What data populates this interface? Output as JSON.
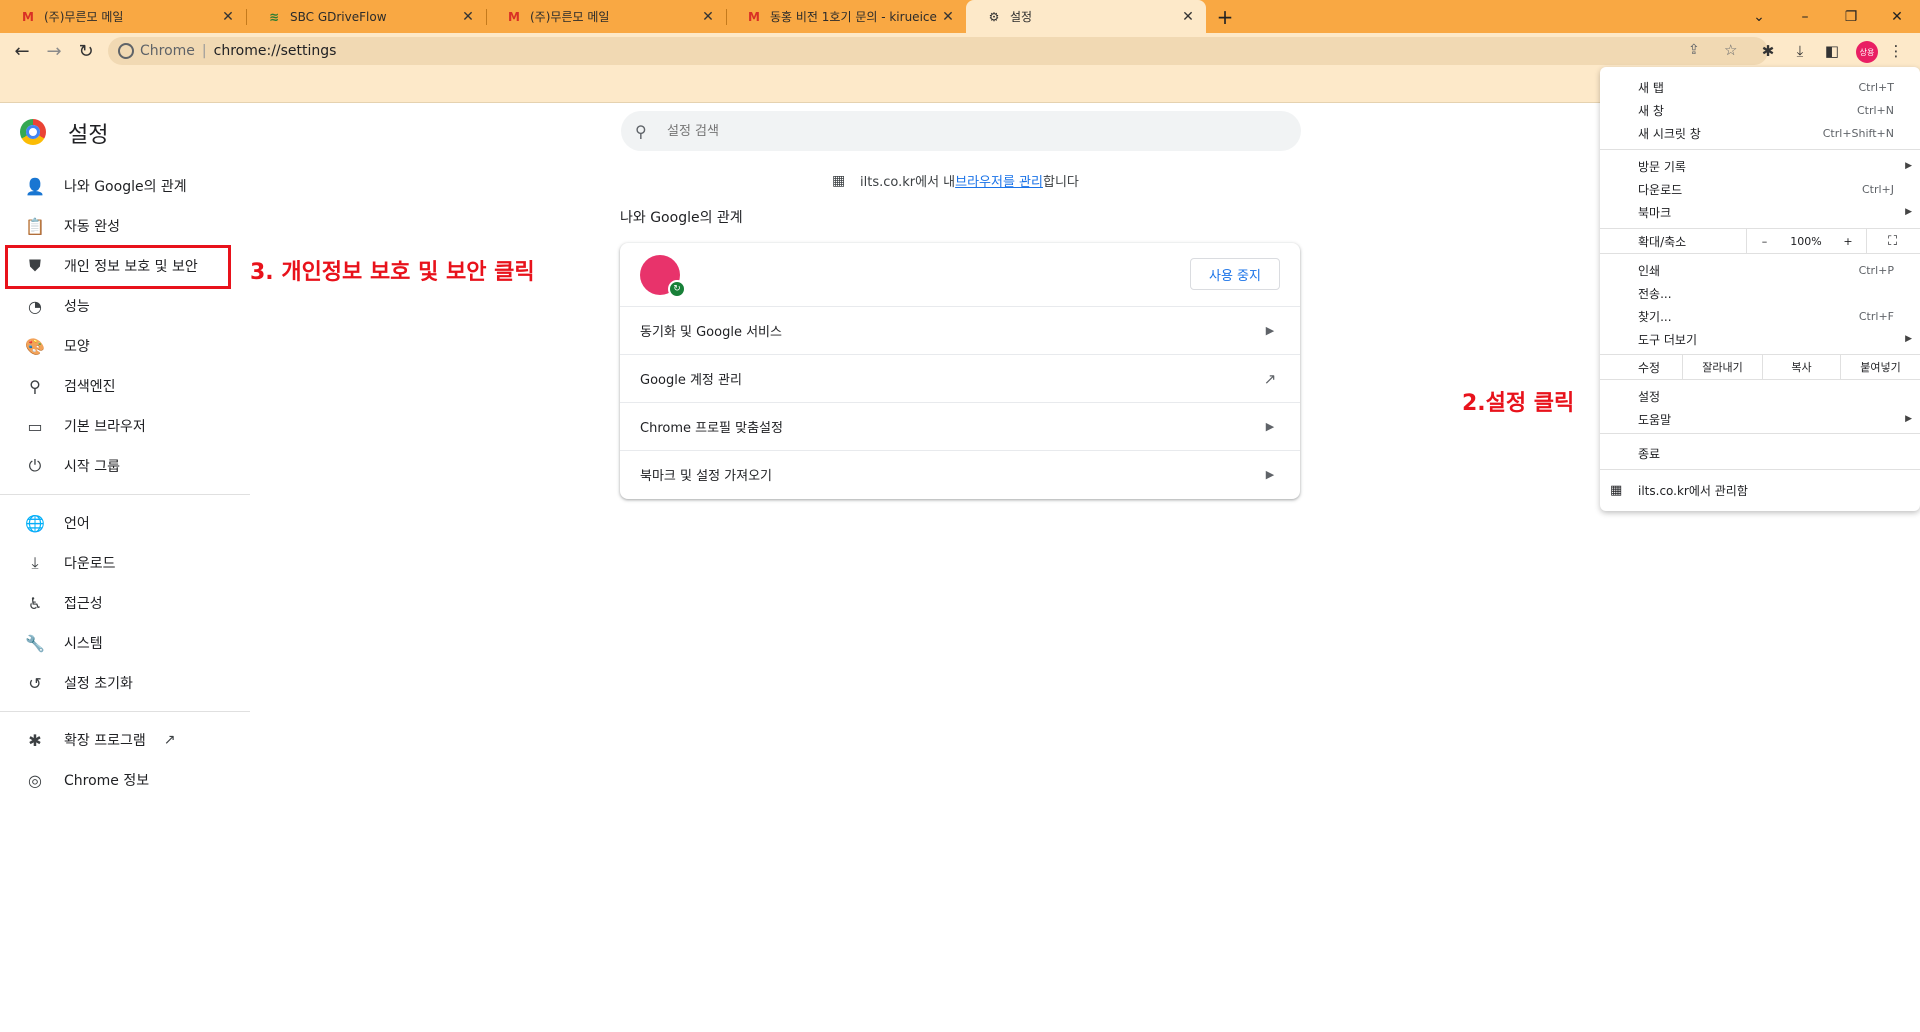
{
  "tabs": [
    {
      "label": "(주)무른모 메일",
      "icon": "gmail-icon"
    },
    {
      "label": "SBC GDriveFlow",
      "icon": "gdriveflow-icon"
    },
    {
      "label": "(주)무른모 메일",
      "icon": "gmail-icon"
    },
    {
      "label": "동홍 비전 1호기 문의 - kirueice",
      "icon": "gmail-icon"
    },
    {
      "label": "설정",
      "icon": "gear-icon"
    }
  ],
  "omnibox": {
    "scheme": "Chrome",
    "url": "chrome://settings"
  },
  "profile": {
    "initials": "상용"
  },
  "settings": {
    "title": "설정",
    "search_placeholder": "설정 검색",
    "managed_prefix": "ilts.co.kr에서 내 ",
    "managed_link": "브라우저를 관리",
    "managed_suffix": "합니다",
    "section_title": "나와 Google의 관계",
    "stop_button": "사용 중지",
    "rows": [
      "동기화 및 Google 서비스",
      "Google 계정 관리",
      "Chrome 프로필 맞춤설정",
      "북마크 및 설정 가져오기"
    ]
  },
  "sidebar": {
    "items": [
      "나와 Google의 관계",
      "자동 완성",
      "개인 정보 보호 및 보안",
      "성능",
      "모양",
      "검색엔진",
      "기본 브라우저",
      "시작 그룹",
      "언어",
      "다운로드",
      "접근성",
      "시스템",
      "설정 초기화",
      "확장 프로그램",
      "Chrome 정보"
    ]
  },
  "annotations": {
    "step3": "3. 개인정보 보호 및 보안 클릭",
    "step2": "2.설정 클릭"
  },
  "menu": {
    "new_tab": "새 탭",
    "new_tab_sc": "Ctrl+T",
    "new_window": "새 창",
    "new_window_sc": "Ctrl+N",
    "incognito": "새 시크릿 창",
    "incognito_sc": "Ctrl+Shift+N",
    "history": "방문 기록",
    "downloads": "다운로드",
    "downloads_sc": "Ctrl+J",
    "bookmarks": "북마크",
    "zoom_label": "확대/축소",
    "zoom_minus": "–",
    "zoom_value": "100%",
    "zoom_plus": "+",
    "print": "인쇄",
    "print_sc": "Ctrl+P",
    "cast": "전송...",
    "find": "찾기...",
    "find_sc": "Ctrl+F",
    "more_tools": "도구 더보기",
    "edit": "수정",
    "cut": "잘라내기",
    "copy": "복사",
    "paste": "붙여넣기",
    "settings": "설정",
    "help": "도움말",
    "exit": "종료",
    "managed": "ilts.co.kr에서 관리함"
  },
  "colors": {
    "tabstrip": "#f9a843",
    "toolbar": "#fde9c9",
    "annotation": "#e8121b",
    "link": "#1a73e8"
  }
}
